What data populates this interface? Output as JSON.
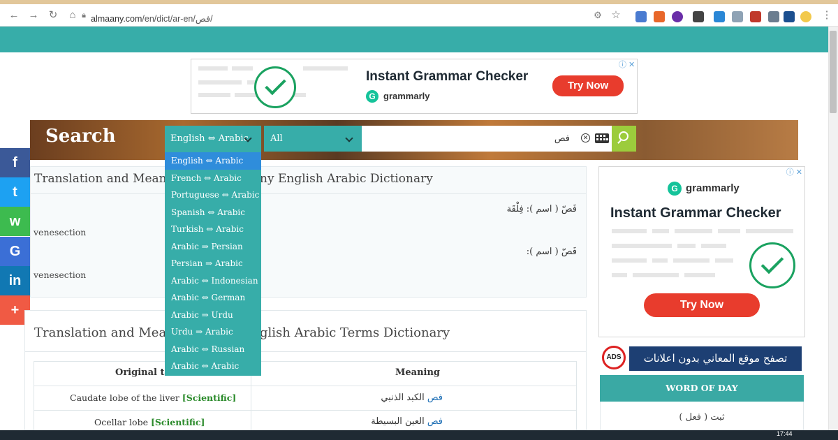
{
  "browser": {
    "url_host": "almaany.com",
    "url_path": "/en/dict/ar-en/فص/"
  },
  "ad_top": {
    "headline": "Instant Grammar Checker",
    "brand": "grammarly",
    "cta": "Try Now"
  },
  "search": {
    "title": "Search",
    "language_selected": "English ⇔ Arabic",
    "category_selected": "All",
    "query": "فص"
  },
  "language_options": [
    "English ⇔ Arabic",
    "French ⇔ Arabic",
    "Portuguese ⇔ Arabic",
    "Spanish ⇔ Arabic",
    "Turkish ⇔ Arabic",
    "Arabic ⇒ Persian",
    "Persian ⇒ Arabic",
    "Arabic ⇔ Indonesian",
    "Arabic ⇔ German",
    "Arabic ⇒ Urdu",
    "Urdu ⇒ Arabic",
    "Arabic ⇔ Russian",
    "Arabic ⇔ Arabic"
  ],
  "share": [
    {
      "icon": "facebook-icon",
      "glyph": "f",
      "color": "#3b5998"
    },
    {
      "icon": "twitter-icon",
      "glyph": "t",
      "color": "#1da1f2"
    },
    {
      "icon": "whatsapp-icon",
      "glyph": "w",
      "color": "#3dbb4f"
    },
    {
      "icon": "google-icon",
      "glyph": "G",
      "color": "#3b6fd6"
    },
    {
      "icon": "linkedin-icon",
      "glyph": "in",
      "color": "#1178b3"
    },
    {
      "icon": "more-icon",
      "glyph": "+",
      "color": "#f05a44"
    }
  ],
  "card1": {
    "heading_left": "Translation and Meaning",
    "heading_right": "ny English Arabic Dictionary",
    "entries": [
      {
        "arabic": "فَصّ ( اسم ): فِلْقَة",
        "english": "venesection"
      },
      {
        "arabic": "فَصّ ( اسم ):",
        "english": "venesection"
      }
    ]
  },
  "card2": {
    "heading_left": "Translation and Meani",
    "heading_right": "glish Arabic Terms Dictionary"
  },
  "terms_table": {
    "header_original": "Original tex",
    "header_meaning": "Meaning",
    "rows": [
      {
        "original": "Caudate lobe of the liver",
        "tag": "[Scientific]",
        "keyword": "فص",
        "meaning": "الكبد الذنبي"
      },
      {
        "original": "Ocellar lobe",
        "tag": "[Scientific]",
        "keyword": "فص",
        "meaning": "العين البسيطة"
      }
    ]
  },
  "ad_side": {
    "brand": "grammarly",
    "headline": "Instant Grammar Checker",
    "cta": "Try Now"
  },
  "no_ads": {
    "text": "تصفح موقع المعاني بدون اعلانات",
    "badge": "ADS"
  },
  "word_of_day": {
    "heading": "WORD OF DAY",
    "word": "ثبت ( فعل )"
  },
  "taskbar": {
    "time": "17:44"
  },
  "colors": {
    "teal": "#37ada9",
    "selected_option": "#2f8ddb",
    "search_button": "#9ccc3c",
    "cta_red": "#e83c2d"
  }
}
